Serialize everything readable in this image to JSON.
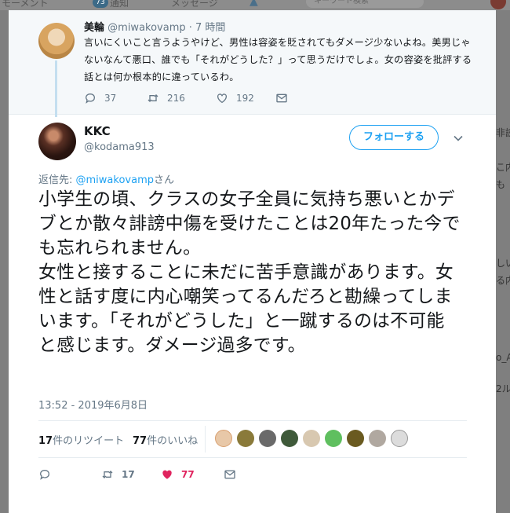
{
  "background": {
    "nav_home": "モーメント",
    "nav_notifications": "通知",
    "notification_badge": "73",
    "nav_messages": "メッセージ",
    "search_placeholder": "キーワード検索",
    "right_fragments": [
      "非読",
      "こ内",
      "も",
      "しい",
      "る内",
      "o_A",
      "2ル"
    ]
  },
  "parent_tweet": {
    "name": "美輪",
    "handle": "@miwakovamp",
    "time": "· 7 時間",
    "text": "言いにくいこと言うようやけど、男性は容姿を貶されてもダメージ少ないよね。美男じゃないなんて悪口、誰でも「それがどうした？」って思うだけでしょ。女の容姿を批評する話とは何か根本的に違っているわ。",
    "reply_count": "37",
    "retweet_count": "216",
    "like_count": "192",
    "icons": [
      "reply-icon",
      "retweet-icon",
      "heart-icon",
      "message-icon"
    ]
  },
  "main_tweet": {
    "name": "KKC",
    "handle": "@kodama913",
    "follow_label": "フォローする",
    "reply_to_prefix": "返信先: ",
    "reply_to_handle": "@miwakovamp",
    "reply_to_suffix": "さん",
    "text": "小学生の頃、クラスの女子全員に気持ち悪いとかデブとか散々誹謗中傷を受けたことは20年たった今でも忘れられません。\n女性と接することに未だに苦手意識があります。女性と話す度に内心嘲笑ってるんだろと勘繰ってしまいます。「それがどうした」と一蹴するのは不可能と感じます。ダメージ過多です。",
    "timestamp": "13:52 - 2019年6月8日",
    "retweets_num": "17",
    "retweets_label": "件のリツイート",
    "likes_num": "77",
    "likes_label": "件のいいね",
    "action_retweet_count": "17",
    "action_like_count": "77",
    "like_color": "#e0245e",
    "accent_color": "#1da1f2"
  }
}
